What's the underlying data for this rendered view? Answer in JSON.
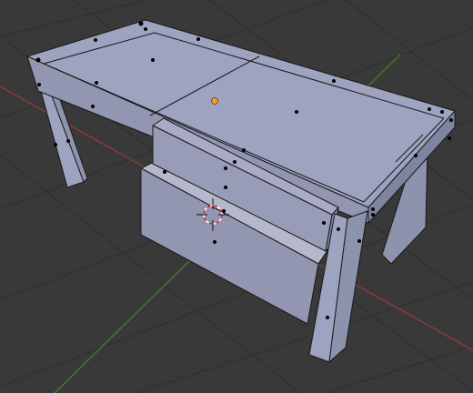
{
  "viewport": {
    "background_color": "#393939",
    "grid_color": "#2e2e2e",
    "x_axis_color": "#8a3a3a",
    "y_axis_color": "#3f7a2e",
    "mesh_face_color": "#9ea3bf",
    "mesh_edge_color": "#1a1a1a",
    "vertex_color": "#000000",
    "origin_color": "#f0a030",
    "cursor_ring_colors": [
      "#cc2222",
      "#ffffff"
    ]
  },
  "scene": {
    "object": "desk",
    "mode": "edit-mode-vertex-select",
    "show_3d_cursor": true,
    "show_origin": true
  }
}
